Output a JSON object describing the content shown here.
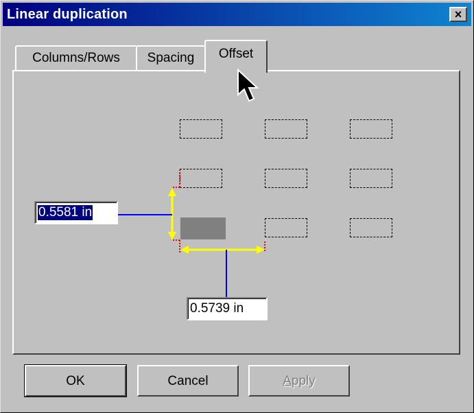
{
  "window": {
    "title": "Linear duplication",
    "close_glyph": "×"
  },
  "tabs": [
    {
      "label": "Columns/Rows",
      "active": false
    },
    {
      "label": "Spacing",
      "active": false
    },
    {
      "label": "Offset",
      "active": true
    }
  ],
  "offset": {
    "vertical_value": "0.5581 in",
    "horizontal_value": "0.5739 in"
  },
  "buttons": {
    "ok": "OK",
    "cancel": "Cancel",
    "apply": "Apply"
  },
  "icons": {
    "cursor": "arrow-cursor-icon"
  },
  "colors": {
    "title_start": "#000080",
    "title_end": "#1084d0",
    "leader_line": "#0000ff",
    "dimension_arrow": "#ffff00",
    "offset_marker": "#ff0000",
    "original_object": "#808080"
  }
}
